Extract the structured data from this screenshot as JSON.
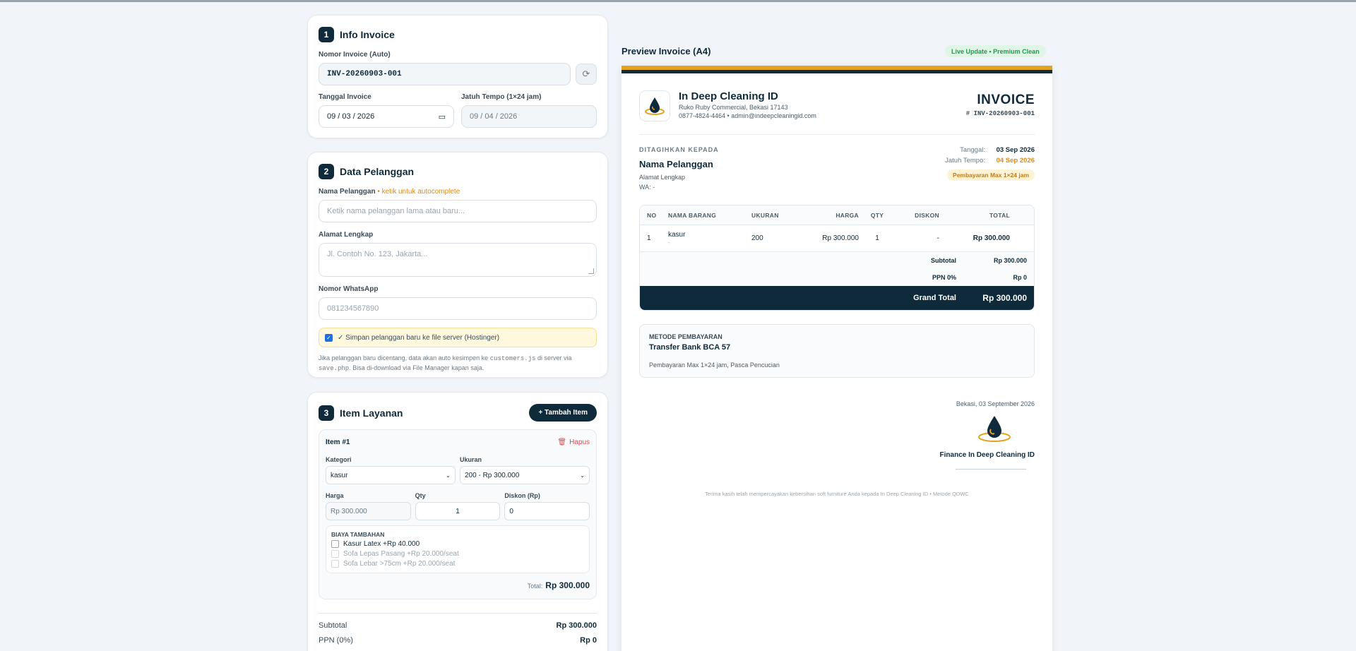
{
  "form": {
    "info": {
      "num": "1",
      "title": "Info Invoice",
      "nomor_label": "Nomor Invoice (Auto)",
      "nomor_value": "INV-20260903-001",
      "tanggal_label": "Tanggal Invoice",
      "tanggal_value": "09 / 03 / 2026",
      "tempo_label": "Jatuh Tempo (1×24 jam)",
      "tempo_value": "09 / 04 / 2026"
    },
    "pelanggan": {
      "num": "2",
      "title": "Data Pelanggan",
      "nama_label": "Nama Pelanggan",
      "nama_hint": "• ketik untuk autocomplete",
      "nama_placeholder": "Ketik nama pelanggan lama atau baru...",
      "alamat_label": "Alamat Lengkap",
      "alamat_placeholder": "Jl. Contoh No. 123, Jakarta...",
      "wa_label": "Nomor WhatsApp",
      "wa_placeholder": "081234567890",
      "save_label": "✓ Simpan pelanggan baru ke file server (Hostinger)",
      "note_1": "Jika pelanggan baru dicentang, data akan auto kesimpen ke",
      "note_file": "customers.js",
      "note_2": "di server via",
      "note_php": "save.php",
      "note_3": ". Bisa di-download via File Manager kapan saja."
    },
    "items": {
      "num": "3",
      "title": "Item Layanan",
      "add_label": "+ Tambah Item",
      "item_title": "Item #1",
      "delete_label": "Hapus",
      "kategori_label": "Kategori",
      "kategori_value": "kasur",
      "ukuran_label": "Ukuran",
      "ukuran_value": "200 - Rp 300.000",
      "harga_label": "Harga",
      "harga_value": "Rp 300.000",
      "qty_label": "Qty",
      "qty_value": "1",
      "diskon_label": "Diskon (Rp)",
      "diskon_value": "0",
      "extra_title": "BIAYA TAMBAHAN",
      "extras": [
        {
          "label": "Kasur Latex +Rp 40.000",
          "enabled": true
        },
        {
          "label": "Sofa Lepas Pasang +Rp 20.000/seat",
          "enabled": false
        },
        {
          "label": "Sofa Lebar >75cm +Rp 20.000/seat",
          "enabled": false
        }
      ],
      "total_label": "Total:",
      "total_value": "Rp 300.000"
    },
    "summary": {
      "subtotal_label": "Subtotal",
      "subtotal_value": "Rp 300.000",
      "ppn_label": "PPN (0%)",
      "ppn_value": "Rp 0"
    }
  },
  "preview": {
    "title": "Preview Invoice (A4)",
    "badge": "Live Update • Premium Clean",
    "company_name": "In Deep Cleaning ID",
    "company_addr": "Ruko Ruby Commercial, Bekasi 17143",
    "company_contact": "0877-4824-4464 • admin@indeepcleaningid.com",
    "invoice_word": "INVOICE",
    "invoice_no": "# INV-20260903-001",
    "billto_label": "DITAGIHKAN KEPADA",
    "billto_name": "Nama Pelanggan",
    "billto_addr": "Alamat Lengkap",
    "billto_wa": "WA: -",
    "tanggal_label": "Tanggal:",
    "tanggal_value": "03 Sep 2026",
    "tempo_label": "Jatuh Tempo:",
    "tempo_value": "04 Sep 2026",
    "tempo_badge": "Pembayaran Max 1×24 jam",
    "table_headers": [
      "NO",
      "NAMA BARANG",
      "UKURAN",
      "HARGA",
      "QTY",
      "DISKON",
      "TOTAL"
    ],
    "row": {
      "no": "1",
      "nama": "kasur",
      "sub": "-",
      "ukuran": "200",
      "harga": "Rp 300.000",
      "qty": "1",
      "diskon": "-",
      "total": "Rp 300.000"
    },
    "subtotal_label": "Subtotal",
    "subtotal_value": "Rp 300.000",
    "ppn_label": "PPN 0%",
    "ppn_value": "Rp 0",
    "grand_label": "Grand Total",
    "grand_value": "Rp 300.000",
    "pay_label": "METODE PEMBAYARAN",
    "pay_method": "Transfer Bank BCA 57",
    "pay_note": "Pembayaran Max 1×24 jam, Pasca Pencucian",
    "sign_place_date": "Bekasi, 03 September 2026",
    "sign_name": "Finance In Deep Cleaning ID",
    "footer": "Terima kasih telah mempercayakan kebersihan soft furniture Anda kepada In Deep Cleaning ID • Metode QDWC",
    "colors": {
      "navy": "#0f2a3a",
      "gold": "#e2a420",
      "orange": "#e08a18"
    }
  }
}
